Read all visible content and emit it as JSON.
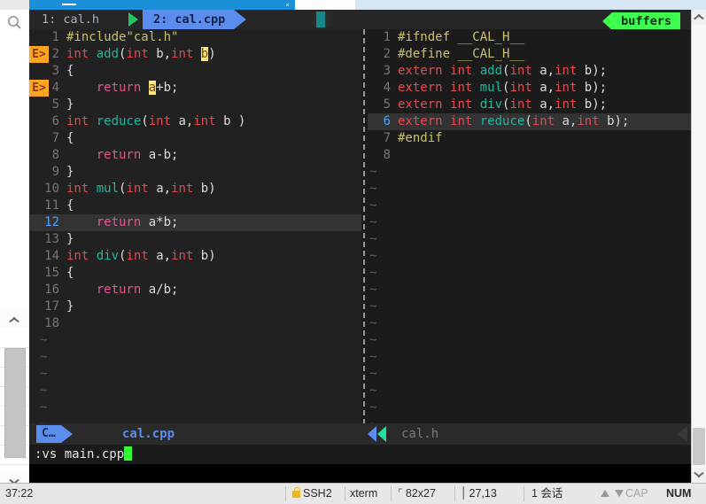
{
  "window": {
    "top_tab_title": "",
    "close_label": "×"
  },
  "sidebar": {
    "search_icon": "search-icon",
    "scroll_up_icon": "chevron-up-icon",
    "scroll_down_icon": "chevron-down-icon"
  },
  "terminal": {
    "tabline": {
      "tabs": [
        {
          "label": "1: cal.h",
          "active": false
        },
        {
          "label": "2: cal.cpp",
          "active": true
        }
      ],
      "buffers_label": "buffers"
    },
    "left_pane": {
      "file": "cal.cpp",
      "cursor_line": 12,
      "error_lines": [
        2,
        4
      ],
      "lines": [
        {
          "n": "1",
          "text": "#include\"cal.h\""
        },
        {
          "n": "2",
          "text": "int add(int b,int b)"
        },
        {
          "n": "3",
          "text": "{"
        },
        {
          "n": "4",
          "text": "    return a+b;"
        },
        {
          "n": "5",
          "text": "}"
        },
        {
          "n": "6",
          "text": "int reduce(int a,int b )"
        },
        {
          "n": "7",
          "text": "{"
        },
        {
          "n": "8",
          "text": "    return a-b;"
        },
        {
          "n": "9",
          "text": "}"
        },
        {
          "n": "10",
          "text": "int mul(int a,int b)"
        },
        {
          "n": "11",
          "text": "{"
        },
        {
          "n": "12",
          "text": "    return a*b;"
        },
        {
          "n": "13",
          "text": "}"
        },
        {
          "n": "14",
          "text": "int div(int a,int b)"
        },
        {
          "n": "15",
          "text": "{"
        },
        {
          "n": "16",
          "text": "    return a/b;"
        },
        {
          "n": "17",
          "text": "}"
        },
        {
          "n": "18",
          "text": ""
        }
      ],
      "tilde": "~"
    },
    "right_pane": {
      "file": "cal.h",
      "cursor_line": 6,
      "lines": [
        {
          "n": "1",
          "text": "#ifndef __CAL_H__"
        },
        {
          "n": "2",
          "text": "#define __CAL_H__"
        },
        {
          "n": "3",
          "text": "extern int add(int a,int b);"
        },
        {
          "n": "4",
          "text": "extern int mul(int a,int b);"
        },
        {
          "n": "5",
          "text": "extern int div(int a,int b);"
        },
        {
          "n": "6",
          "text": "extern int reduce(int a,int b);"
        },
        {
          "n": "7",
          "text": "#endif"
        },
        {
          "n": "8",
          "text": ""
        }
      ],
      "tilde": "~"
    },
    "statusline": {
      "mode_badge": "C…",
      "active_file": "cal.cpp",
      "inactive_file": "cal.h"
    },
    "cmdline": {
      "text": ":vs main.cpp"
    }
  },
  "statusbar": {
    "elapsed": "37:22",
    "protocol": "SSH2",
    "term_type": "xterm",
    "size": "82x27",
    "position": "27,13",
    "sessions": "1 会话",
    "cap": "CAP",
    "num": "NUM"
  },
  "colors": {
    "accent_blue": "#5b8def",
    "buffers_green": "#3dfd4f",
    "error_orange": "#ffa51f",
    "error_highlight": "#ffe680",
    "cursor_green": "#33ff33"
  }
}
